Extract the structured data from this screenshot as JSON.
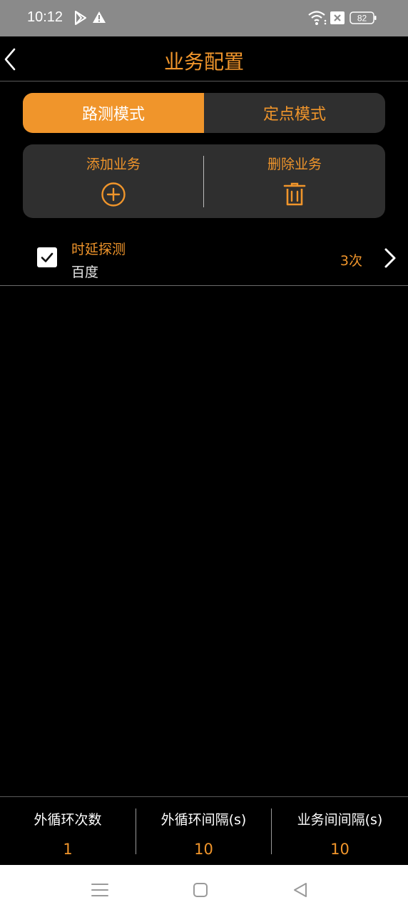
{
  "status_bar": {
    "time": "10:12",
    "battery": "82"
  },
  "header": {
    "title": "业务配置"
  },
  "modes": [
    {
      "label": "路测模式",
      "active": true
    },
    {
      "label": "定点模式",
      "active": false
    }
  ],
  "actions": {
    "add_label": "添加业务",
    "delete_label": "删除业务"
  },
  "services": [
    {
      "name": "时延探测",
      "target": "百度",
      "count": "3次",
      "checked": true
    }
  ],
  "settings": [
    {
      "label": "外循环次数",
      "value": "1"
    },
    {
      "label": "外循环间隔(s)",
      "value": "10"
    },
    {
      "label": "业务间间隔(s)",
      "value": "10"
    }
  ],
  "colors": {
    "accent": "#f0952b",
    "panel": "#2f2f2f",
    "background": "#000000"
  }
}
